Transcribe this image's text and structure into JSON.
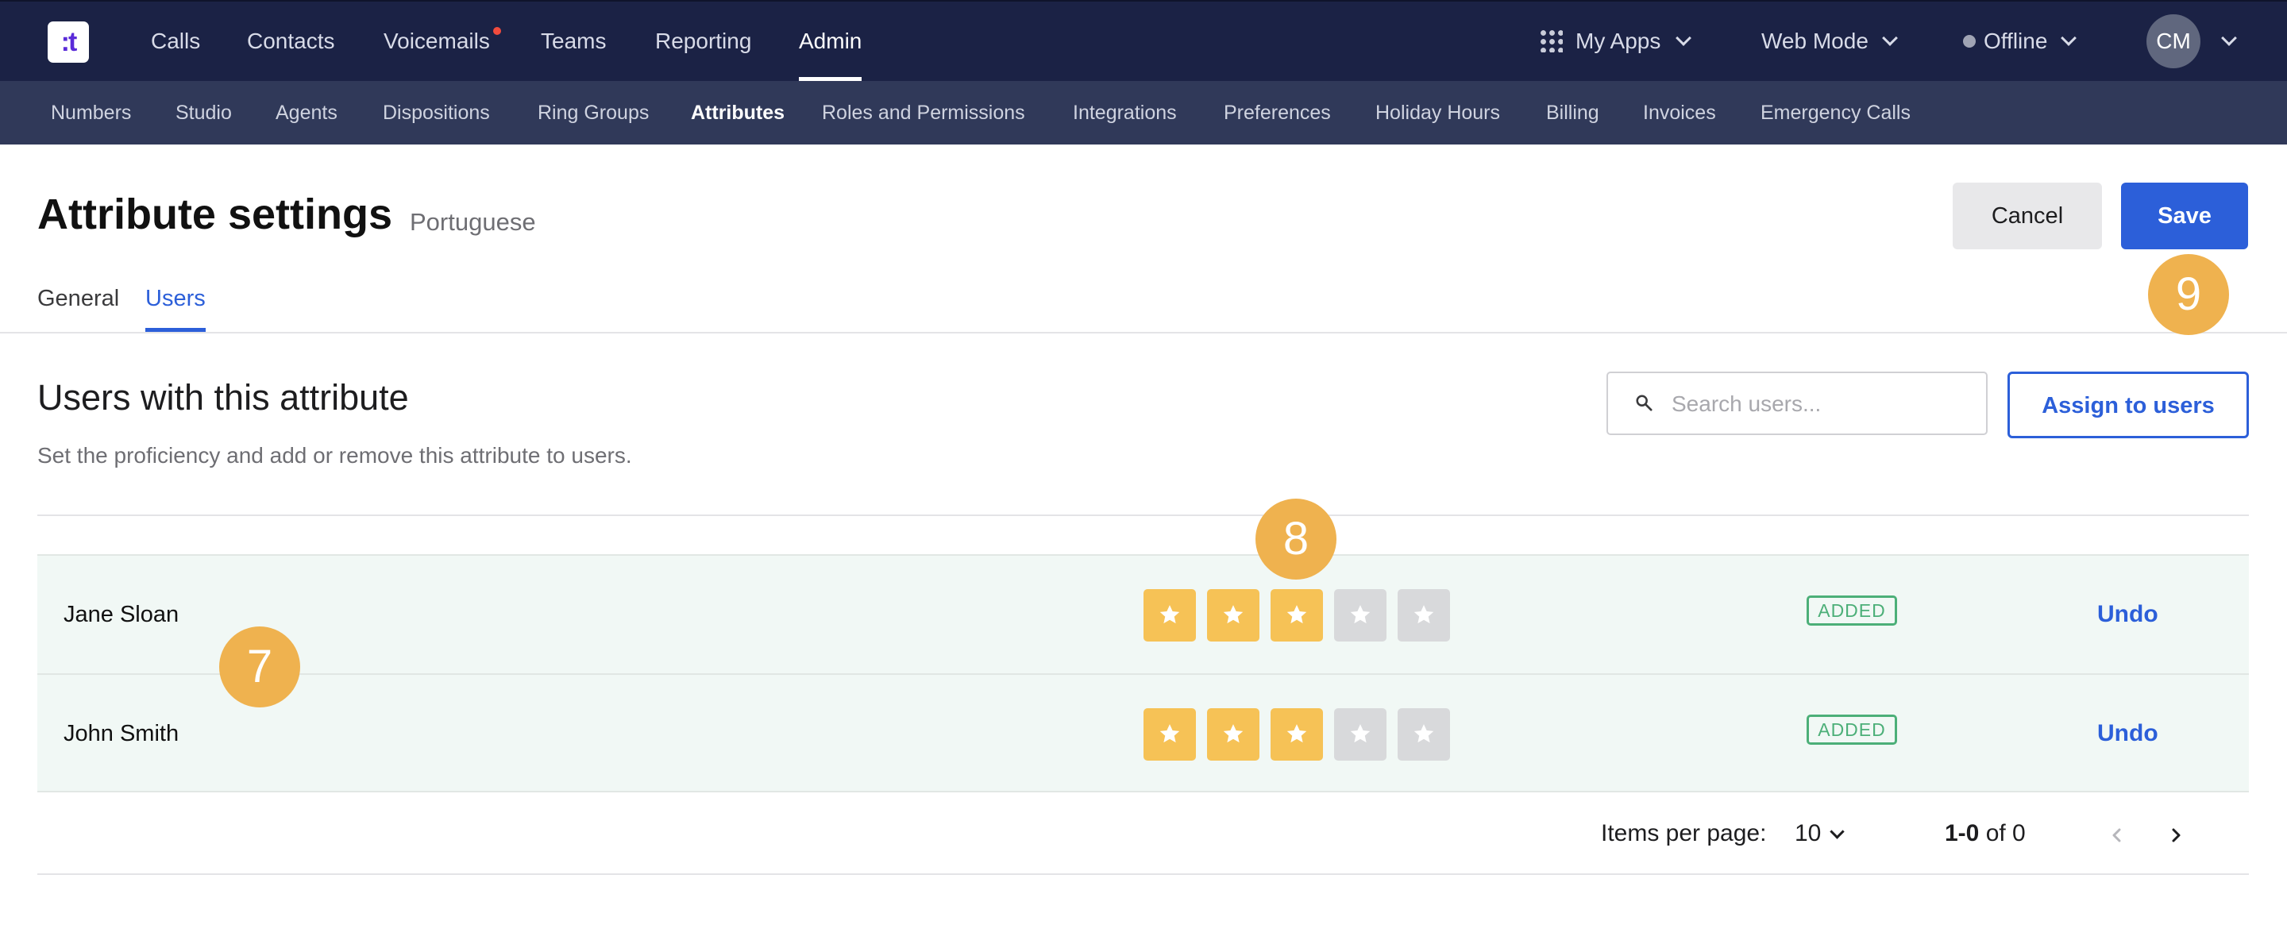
{
  "app": {
    "logo_text": ":t"
  },
  "top_nav": {
    "items": [
      {
        "label": "Calls"
      },
      {
        "label": "Contacts"
      },
      {
        "label": "Voicemails"
      },
      {
        "label": "Teams"
      },
      {
        "label": "Reporting"
      },
      {
        "label": "Admin"
      }
    ],
    "active": "Admin",
    "my_apps_label": "My Apps",
    "mode_label": "Web Mode",
    "status_label": "Offline",
    "avatar_initials": "CM"
  },
  "sub_nav": {
    "items": [
      {
        "label": "Numbers"
      },
      {
        "label": "Studio"
      },
      {
        "label": "Agents"
      },
      {
        "label": "Dispositions"
      },
      {
        "label": "Ring Groups"
      },
      {
        "label": "Attributes"
      },
      {
        "label": "Roles and Permissions"
      },
      {
        "label": "Integrations"
      },
      {
        "label": "Preferences"
      },
      {
        "label": "Holiday Hours"
      },
      {
        "label": "Billing"
      },
      {
        "label": "Invoices"
      },
      {
        "label": "Emergency Calls"
      }
    ],
    "active": "Attributes"
  },
  "header": {
    "title": "Attribute settings",
    "subtitle": "Portuguese",
    "cancel_label": "Cancel",
    "save_label": "Save"
  },
  "tabs": [
    {
      "label": "General"
    },
    {
      "label": "Users"
    }
  ],
  "active_tab": "Users",
  "section": {
    "title": "Users with this attribute",
    "description": "Set the proficiency and add or remove this attribute to users.",
    "search_placeholder": "Search users...",
    "assign_label": "Assign to users"
  },
  "users": [
    {
      "name": "Jane Sloan",
      "rating": 3,
      "max_rating": 5,
      "badge": "ADDED",
      "action": "Undo"
    },
    {
      "name": "John Smith",
      "rating": 3,
      "max_rating": 5,
      "badge": "ADDED",
      "action": "Undo"
    }
  ],
  "pagination": {
    "items_per_page_label": "Items per page:",
    "items_per_page_value": "10",
    "range_bold": "1-0",
    "range_rest": "of 0"
  },
  "markers": {
    "m7": "7",
    "m8": "8",
    "m9": "9"
  },
  "colors": {
    "topbar": "#1b2245",
    "subbar": "#303959",
    "accent": "#2c5fd9",
    "star_on": "#f6c256",
    "star_off": "#d8d9db",
    "badge_green": "#4caf78",
    "marker": "#efb24f",
    "row_bg": "#f1f8f5",
    "notification": "#f24b3d"
  },
  "icons": {
    "logo": "app-logo",
    "apps": "grid-icon",
    "chevron": "chevron-down-icon",
    "status": "status-dot-icon",
    "search": "search-icon",
    "star": "star-icon",
    "prev": "chevron-left-icon",
    "next": "chevron-right-icon"
  }
}
